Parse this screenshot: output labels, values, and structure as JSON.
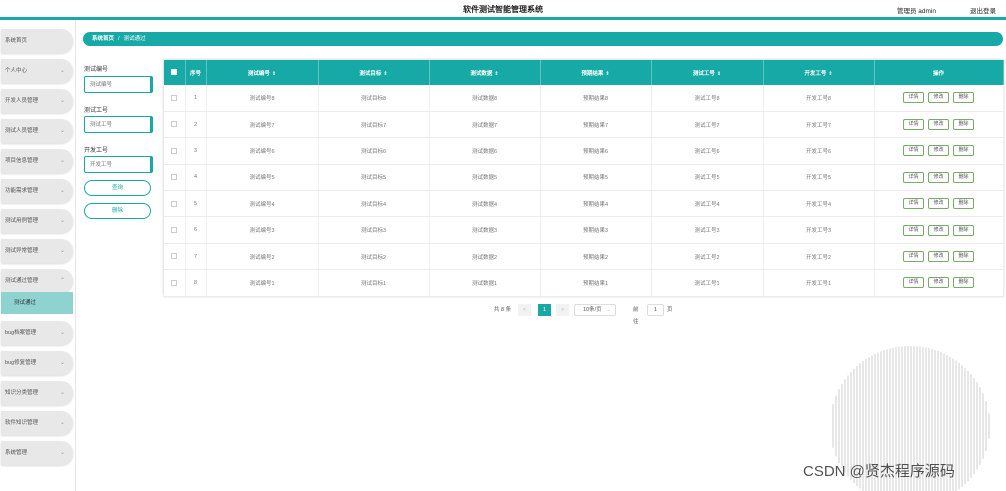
{
  "header": {
    "title": "软件测试智能管理系统",
    "user": "管理员 admin",
    "logout": "退出登录"
  },
  "sidebar": {
    "items": [
      {
        "label": "系统首页",
        "chev": ""
      },
      {
        "label": "个人中心",
        "chev": "⌄"
      },
      {
        "label": "开发人员管理",
        "chev": "⌄"
      },
      {
        "label": "测试人员管理",
        "chev": "⌄"
      },
      {
        "label": "项目信息管理",
        "chev": "⌄"
      },
      {
        "label": "功能需求管理",
        "chev": "⌄"
      },
      {
        "label": "测试用例管理",
        "chev": "⌄"
      },
      {
        "label": "测试异常管理",
        "chev": "⌄"
      },
      {
        "label": "测试通过管理",
        "chev": "⌃"
      },
      {
        "label": "bug档案管理",
        "chev": "⌄"
      },
      {
        "label": "bug修复管理",
        "chev": "⌄"
      },
      {
        "label": "知识分类管理",
        "chev": "⌄"
      },
      {
        "label": "软件知识管理",
        "chev": "⌄"
      },
      {
        "label": "系统管理",
        "chev": "⌄"
      }
    ],
    "active_sub": "测试通过"
  },
  "breadcrumb": {
    "home": "系统首页",
    "sep": "/",
    "current": "测试通过"
  },
  "filters": {
    "f1_label": "测试编号",
    "f1_placeholder": "测试编号",
    "f2_label": "测试工号",
    "f2_placeholder": "测试工号",
    "f3_label": "开发工号",
    "f3_placeholder": "开发工号",
    "query": "查询",
    "delete": "删除"
  },
  "table": {
    "headers": [
      "序号",
      "测试编号",
      "测试目标",
      "测试数据",
      "预期结果",
      "测试工号",
      "开发工号",
      "操作"
    ],
    "sort_icon": "⇕",
    "rows": [
      {
        "no": "1",
        "code": "测试编号8",
        "target": "测试目标8",
        "data": "测试数据8",
        "expect": "预期结果8",
        "tester": "测试工号8",
        "dev": "开发工号8"
      },
      {
        "no": "2",
        "code": "测试编号7",
        "target": "测试目标7",
        "data": "测试数据7",
        "expect": "预期结果7",
        "tester": "测试工号7",
        "dev": "开发工号7"
      },
      {
        "no": "3",
        "code": "测试编号6",
        "target": "测试目标6",
        "data": "测试数据6",
        "expect": "预期结果6",
        "tester": "测试工号6",
        "dev": "开发工号6"
      },
      {
        "no": "4",
        "code": "测试编号5",
        "target": "测试目标5",
        "data": "测试数据5",
        "expect": "预期结果5",
        "tester": "测试工号5",
        "dev": "开发工号5"
      },
      {
        "no": "5",
        "code": "测试编号4",
        "target": "测试目标4",
        "data": "测试数据4",
        "expect": "预期结果4",
        "tester": "测试工号4",
        "dev": "开发工号4"
      },
      {
        "no": "6",
        "code": "测试编号3",
        "target": "测试目标3",
        "data": "测试数据3",
        "expect": "预期结果3",
        "tester": "测试工号3",
        "dev": "开发工号3"
      },
      {
        "no": "7",
        "code": "测试编号2",
        "target": "测试目标2",
        "data": "测试数据2",
        "expect": "预期结果2",
        "tester": "测试工号2",
        "dev": "开发工号2"
      },
      {
        "no": "8",
        "code": "测试编号1",
        "target": "测试目标1",
        "data": "测试数据1",
        "expect": "预期结果1",
        "tester": "测试工号1",
        "dev": "开发工号1"
      }
    ],
    "actions": [
      "详情",
      "修改",
      "删除"
    ]
  },
  "pager": {
    "total": "共 8 条",
    "prev": "<",
    "current": "1",
    "next": ">",
    "size": "10条/页",
    "goto": "前往",
    "page_input": "1",
    "page_suffix": "页"
  },
  "watermark": "CSDN @贤杰程序源码",
  "colors": {
    "accent": "#17a9a5",
    "submenu_active": "#8fd3d1",
    "menu_bg": "#e8e8e8"
  }
}
